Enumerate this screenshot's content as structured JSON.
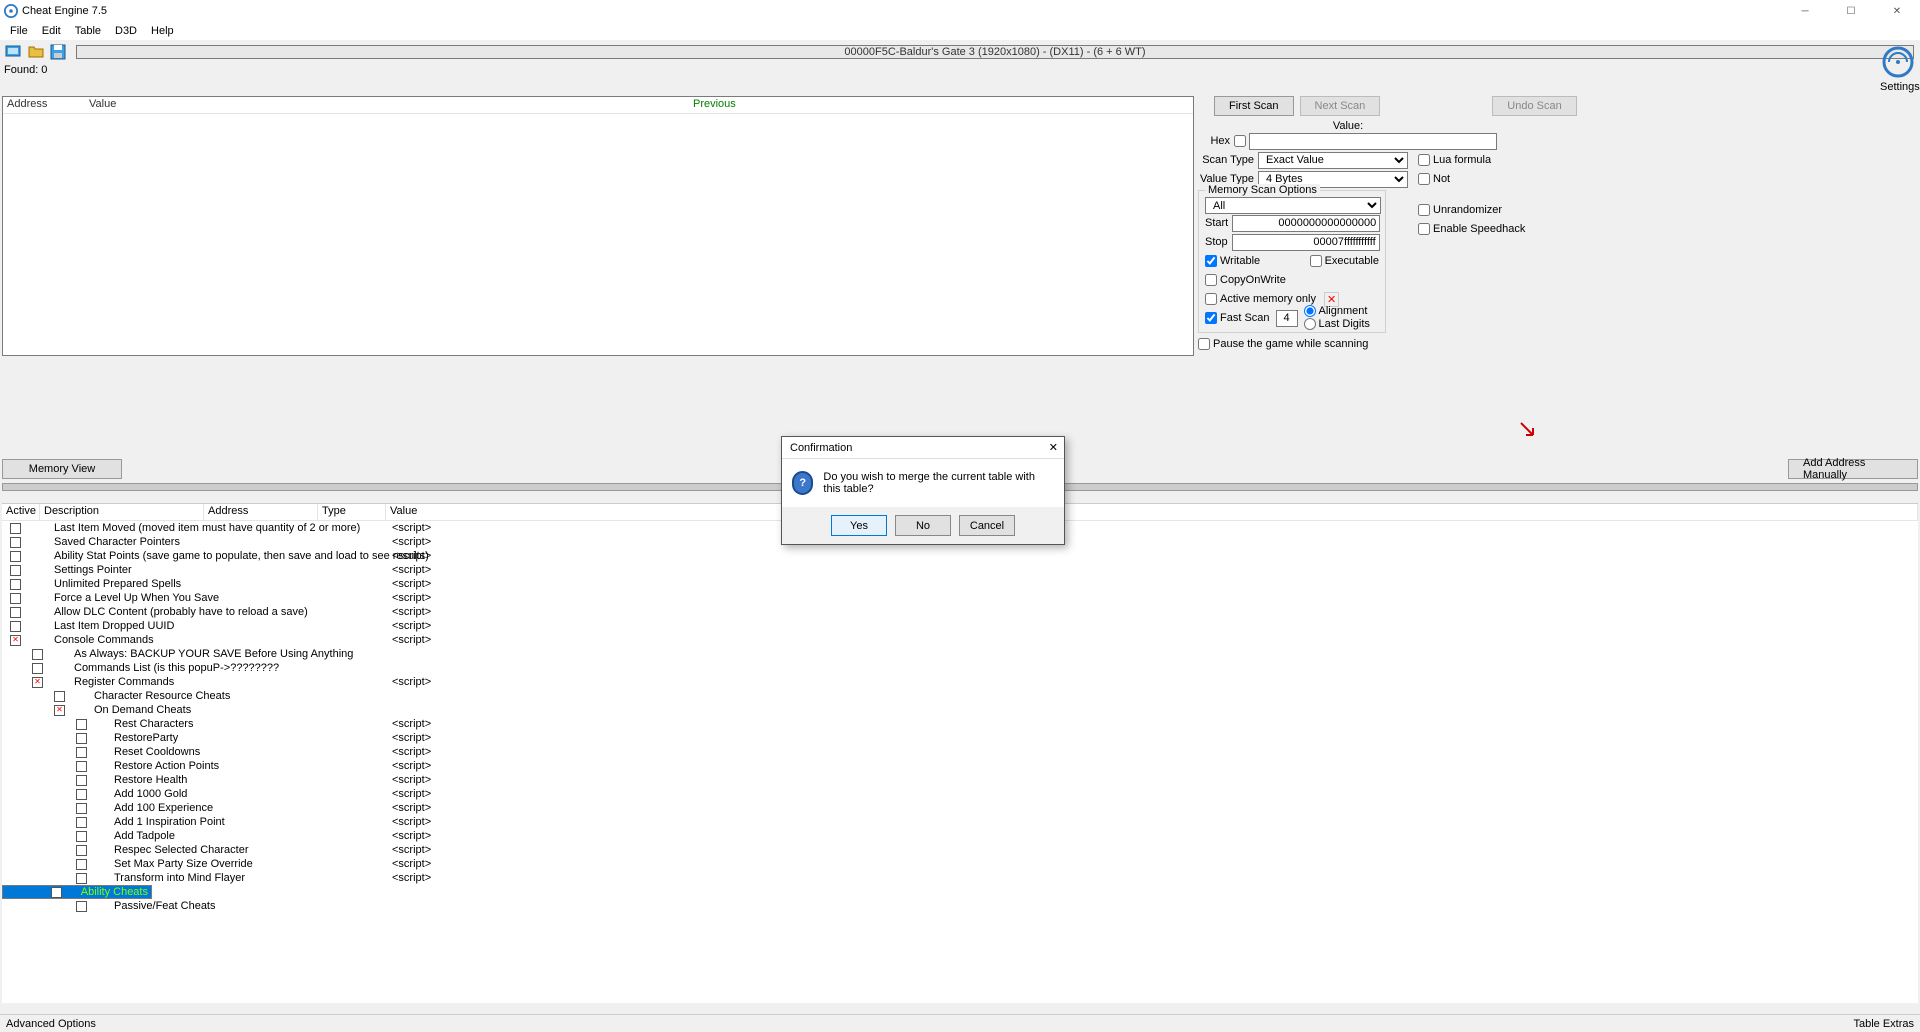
{
  "title": "Cheat Engine 7.5",
  "menus": [
    "File",
    "Edit",
    "Table",
    "D3D",
    "Help"
  ],
  "process": "00000F5C-Baldur's Gate 3 (1920x1080) - (DX11) - (6 + 6 WT)",
  "settings_label": "Settings",
  "found": "Found: 0",
  "col_address": "Address",
  "col_value": "Value",
  "col_prev": "Previous",
  "btn_first": "First Scan",
  "btn_next": "Next Scan",
  "btn_undo": "Undo Scan",
  "lbl_value": "Value:",
  "lbl_hex": "Hex",
  "lbl_scantype": "Scan Type",
  "scan_type": "Exact Value",
  "lbl_valtype": "Value Type",
  "val_type": "4 Bytes",
  "chk_lua": "Lua formula",
  "chk_not": "Not",
  "memopts": "Memory Scan Options",
  "mem_all": "All",
  "lbl_start": "Start",
  "start_v": "0000000000000000",
  "lbl_stop": "Stop",
  "stop_v": "00007fffffffffff",
  "chk_writable": "Writable",
  "chk_exec": "Executable",
  "chk_cow": "CopyOnWrite",
  "chk_amo": "Active memory only",
  "chk_fast": "Fast Scan",
  "fast_v": "4",
  "rd_align": "Alignment",
  "rd_last": "Last Digits",
  "chk_unrand": "Unrandomizer",
  "chk_speed": "Enable Speedhack",
  "chk_pause": "Pause the game while scanning",
  "btn_memview": "Memory View",
  "btn_addman": "Add Address Manually",
  "hdr_active": "Active",
  "hdr_desc": "Description",
  "hdr_addr": "Address",
  "hdr_type": "Type",
  "hdr_val": "Value",
  "dialog": {
    "title": "Confirmation",
    "msg": "Do you wish to merge the current table with this table?",
    "yes": "Yes",
    "no": "No",
    "cancel": "Cancel"
  },
  "status_left": "Advanced Options",
  "status_right": "Table Extras",
  "rows": [
    {
      "i": 0,
      "d": "Last Item Moved (moved item must have quantity of 2 or more)",
      "t": "<script>"
    },
    {
      "i": 0,
      "d": "Saved Character Pointers",
      "t": "<script>"
    },
    {
      "i": 0,
      "d": "Ability Stat Points (save game to populate, then save and load to see results)",
      "t": "<script>"
    },
    {
      "i": 0,
      "d": "Settings Pointer",
      "t": "<script>"
    },
    {
      "i": 0,
      "d": "Unlimited Prepared Spells",
      "t": "<script>"
    },
    {
      "i": 0,
      "d": "Force a Level Up When You Save",
      "t": "<script>"
    },
    {
      "i": 0,
      "d": "Allow DLC Content (probably have to reload a save)",
      "t": "<script>"
    },
    {
      "i": 0,
      "d": "Last Item Dropped UUID",
      "t": "<script>"
    },
    {
      "i": 0,
      "d": "Console Commands",
      "t": "<script>",
      "x": true
    },
    {
      "i": 1,
      "d": "As Always: BACKUP YOUR SAVE Before Using Anything"
    },
    {
      "i": 1,
      "d": "Commands List (is this popuP->????????"
    },
    {
      "i": 1,
      "d": "Register Commands",
      "t": "<script>",
      "x": true
    },
    {
      "i": 2,
      "d": "Character Resource Cheats"
    },
    {
      "i": 2,
      "d": "On Demand Cheats",
      "x": true
    },
    {
      "i": 3,
      "d": "Rest Characters",
      "t": "<script>"
    },
    {
      "i": 3,
      "d": "RestoreParty",
      "t": "<script>"
    },
    {
      "i": 3,
      "d": "Reset Cooldowns",
      "t": "<script>"
    },
    {
      "i": 3,
      "d": "Restore Action Points",
      "t": "<script>"
    },
    {
      "i": 3,
      "d": "Restore Health",
      "t": "<script>"
    },
    {
      "i": 3,
      "d": "Add 1000 Gold",
      "t": "<script>"
    },
    {
      "i": 3,
      "d": "Add 100 Experience",
      "t": "<script>"
    },
    {
      "i": 3,
      "d": "Add 1 Inspiration Point",
      "t": "<script>"
    },
    {
      "i": 3,
      "d": "Add Tadpole",
      "t": "<script>"
    },
    {
      "i": 3,
      "d": "Respec Selected Character",
      "t": "<script>"
    },
    {
      "i": 3,
      "d": "Set Max Party Size Override",
      "t": "<script>"
    },
    {
      "i": 3,
      "d": "Transform into Mind Flayer",
      "t": "<script>"
    },
    {
      "i": 3,
      "d": "Ability Cheats",
      "sel": true
    },
    {
      "i": 3,
      "d": "Passive/Feat Cheats"
    }
  ]
}
